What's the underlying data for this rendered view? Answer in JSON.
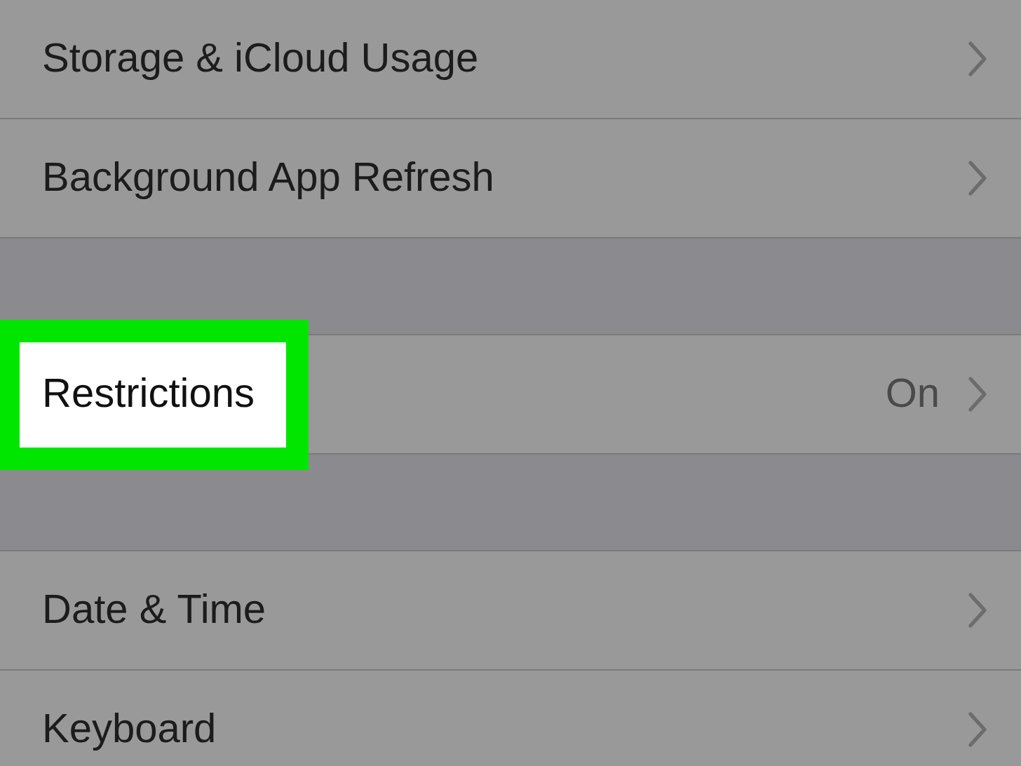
{
  "groups": [
    {
      "rows": [
        {
          "label": "Storage & iCloud Usage",
          "highlighted": false
        },
        {
          "label": "Background App Refresh",
          "highlighted": false
        }
      ]
    },
    {
      "rows": [
        {
          "label": "Restrictions",
          "value": "On",
          "highlighted": true
        }
      ]
    },
    {
      "rows": [
        {
          "label": "Date & Time",
          "highlighted": false
        },
        {
          "label": "Keyboard",
          "highlighted": false
        }
      ]
    }
  ]
}
